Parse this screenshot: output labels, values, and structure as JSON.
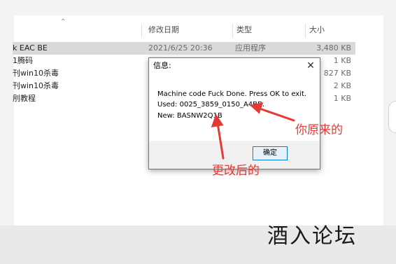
{
  "explorer": {
    "columns": {
      "date": "修改日期",
      "type": "类型",
      "size": "大小"
    },
    "files": [
      {
        "name": "k EAC BE",
        "date": "2021/6/25 20:36",
        "type": "应用程序",
        "size": "3,480 KB",
        "selected": true
      },
      {
        "name": "1腾码",
        "date": "",
        "type": "",
        "size": "1 KB",
        "selected": false
      },
      {
        "name": "刊win10杀毒",
        "date": "",
        "type": "",
        "size": "827 KB",
        "selected": false
      },
      {
        "name": "刊win10杀毒",
        "date": "",
        "type": "",
        "size": "2 KB",
        "selected": false
      },
      {
        "name": "刖教程",
        "date": "",
        "type": "",
        "size": "1 KB",
        "selected": false
      }
    ]
  },
  "dialog": {
    "title": "信息:",
    "message": "Machine code Fuck Done. Press OK to exit.",
    "used_label": "Used:",
    "used_value": "0025_3859_0150_A4BB.",
    "new_label": "New:",
    "new_value": "BASNW2Q1B",
    "ok_label": "确定"
  },
  "annotations": {
    "original": "你原来的",
    "changed": "更改后的",
    "color": "#e53935"
  },
  "watermark": "酒入论坛",
  "icons": [
    "sort-up-icon",
    "close-icon",
    "arrow-icon"
  ]
}
